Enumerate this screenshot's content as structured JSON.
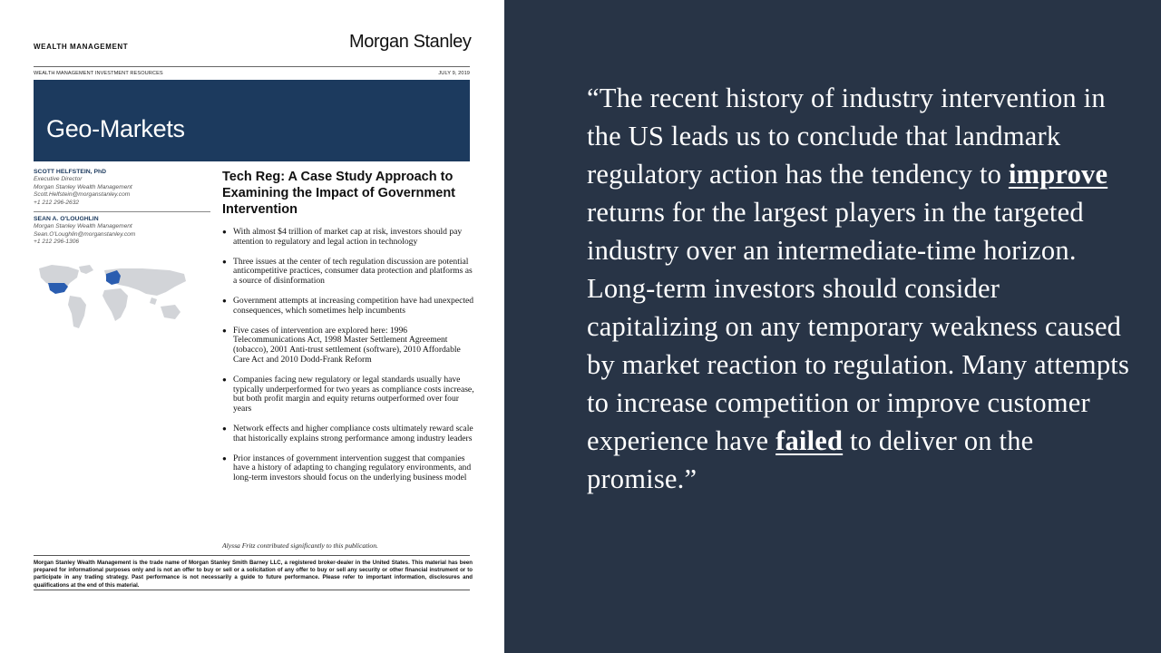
{
  "document": {
    "brand_label": "WEALTH MANAGEMENT",
    "logo_text": "Morgan Stanley",
    "resources_label": "WEALTH MANAGEMENT INVESTMENT RESOURCES",
    "date": "JULY 9, 2019",
    "banner_title": "Geo-Markets",
    "banner_color": "#1c3a5e",
    "authors": [
      {
        "name": "SCOTT HELFSTEIN, PhD",
        "role": "Executive Director",
        "firm": "Morgan Stanley Wealth Management",
        "email": "Scott.Helfstein@morganstanley.com",
        "phone": "+1 212 296-2632"
      },
      {
        "name": "SEAN A. O'LOUGHLIN",
        "firm": "Morgan Stanley Wealth Management",
        "email": "Sean.O'Loughlin@morganstanley.com",
        "phone": "+1 212 296-1306"
      }
    ],
    "map_highlight_color": "#2a5db0",
    "title": "Tech Reg: A Case Study Approach to Examining the Impact of Government Intervention",
    "bullets": [
      "With almost $4 trillion of market cap at risk, investors should pay attention to regulatory and legal action in technology",
      "Three issues at the center of tech regulation discussion are potential anticompetitive practices, consumer data protection and platforms as a source of disinformation",
      "Government attempts at increasing competition have had unexpected consequences, which sometimes help incumbents",
      "Five cases of intervention are explored here: 1996 Telecommunications Act, 1998 Master Settlement Agreement (tobacco), 2001 Anti-trust settlement (software), 2010 Affordable Care Act and 2010 Dodd-Frank Reform",
      "Companies facing new regulatory or legal standards usually have typically underperformed for two years as compliance costs increase, but both profit margin and equity returns outperformed over four years",
      "Network effects and higher compliance costs ultimately reward scale that historically explains strong performance among industry leaders",
      "Prior instances of government intervention suggest that companies have a history of adapting to changing regulatory environments, and long-term investors should focus on the underlying business model"
    ],
    "contribution_note": "Alyssa Fritz contributed significantly to this publication.",
    "disclaimer": "Morgan Stanley Wealth Management is the trade name of Morgan Stanley Smith Barney LLC, a registered broker-dealer in the United States.  This material has been prepared for informational purposes only and is not an offer to buy or sell or a solicitation of any offer to buy or sell any security or other financial instrument or to participate in any trading strategy. Past performance is not necessarily a guide to future performance. Please refer to important information, disclosures and qualifications at the end of this material."
  },
  "quote": {
    "panel_color": "#283446",
    "part1": "“The recent history of industry intervention in the US leads us to conclude that landmark regulatory action has the tendency to ",
    "emphasis1": "improve",
    "part2": " returns for the largest players in the targeted industry over an intermediate-time horizon. Long-term investors should consider capitalizing on any temporary weakness caused by market reaction to regulation. Many attempts to increase competition or improve customer experience have ",
    "emphasis2": "failed",
    "part3": " to deliver on the promise.”"
  }
}
